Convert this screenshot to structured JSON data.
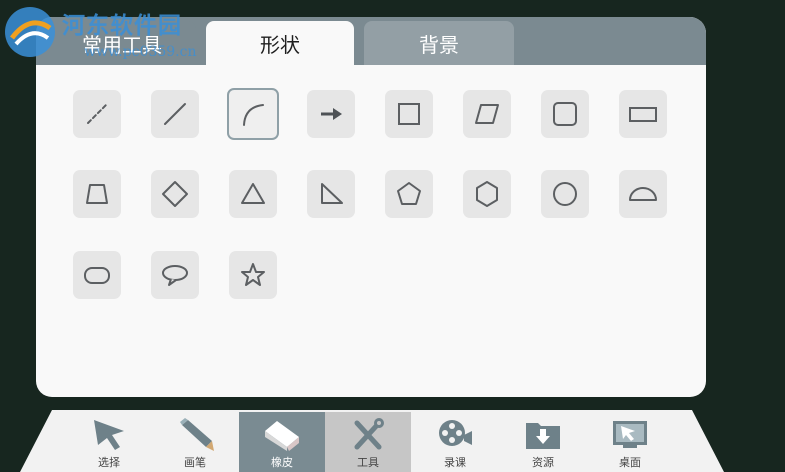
{
  "watermark": {
    "title": "河东软件园",
    "url": "www.pc0359.cn"
  },
  "tabs": [
    {
      "label": "常用工具",
      "active": false
    },
    {
      "label": "形状",
      "active": true
    },
    {
      "label": "背景",
      "active": false
    }
  ],
  "shapes": [
    {
      "icon": "dashed-line-icon",
      "selected": false
    },
    {
      "icon": "line-icon",
      "selected": false
    },
    {
      "icon": "arc-icon",
      "selected": true
    },
    {
      "icon": "arrow-icon",
      "selected": false
    },
    {
      "icon": "square-icon",
      "selected": false
    },
    {
      "icon": "parallelogram-icon",
      "selected": false
    },
    {
      "icon": "rounded-square-icon",
      "selected": false
    },
    {
      "icon": "rectangle-icon",
      "selected": false
    },
    {
      "icon": "trapezoid-icon",
      "selected": false
    },
    {
      "icon": "diamond-icon",
      "selected": false
    },
    {
      "icon": "triangle-icon",
      "selected": false
    },
    {
      "icon": "right-triangle-icon",
      "selected": false
    },
    {
      "icon": "pentagon-icon",
      "selected": false
    },
    {
      "icon": "hexagon-icon",
      "selected": false
    },
    {
      "icon": "circle-icon",
      "selected": false
    },
    {
      "icon": "semicircle-icon",
      "selected": false
    },
    {
      "icon": "rounded-rectangle-icon",
      "selected": false
    },
    {
      "icon": "speech-bubble-icon",
      "selected": false
    },
    {
      "icon": "star-icon",
      "selected": false
    }
  ],
  "toolbar": {
    "items": [
      {
        "label": "选择",
        "icon": "cursor-arrow-icon"
      },
      {
        "label": "画笔",
        "icon": "pen-icon"
      },
      {
        "label": "橡皮",
        "icon": "eraser-icon",
        "state": "active"
      },
      {
        "label": "工具",
        "icon": "tools-icon",
        "state": "pressed"
      },
      {
        "label": "录课",
        "icon": "film-camera-icon"
      },
      {
        "label": "资源",
        "icon": "download-folder-icon"
      },
      {
        "label": "桌面",
        "icon": "desktop-icon"
      }
    ]
  },
  "colors": {
    "board": "#17261f",
    "tab_bar": "#7b8a91",
    "panel": "#f9f9f9",
    "active_toolbar_item": "#7a8b92",
    "icon_stroke": "#5c5f62"
  }
}
